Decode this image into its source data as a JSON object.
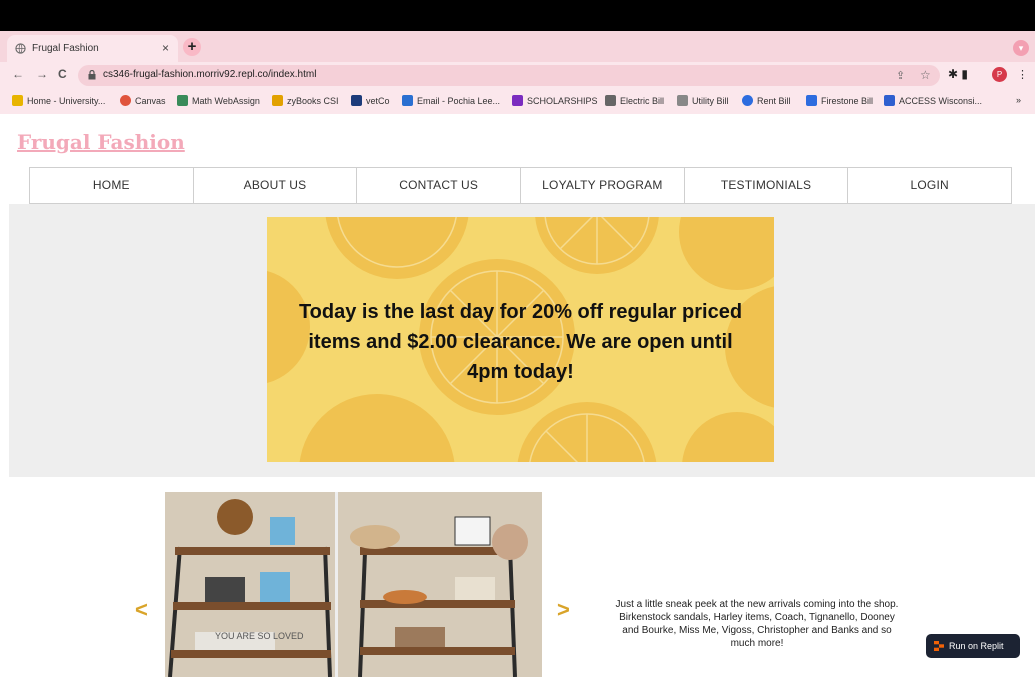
{
  "browser": {
    "tab_title": "Frugal Fashion",
    "tab_close": "×",
    "new_tab": "+",
    "url": "cs346-frugal-fashion.morriv92.repl.co/index.html",
    "back": "←",
    "forward": "→",
    "reload": "C",
    "bookmarks": [
      {
        "label": "Home - University...",
        "color": "#e8b400"
      },
      {
        "label": "Canvas",
        "color": "#e0533c"
      },
      {
        "label": "Math WebAssign",
        "color": "#3a8b5a"
      },
      {
        "label": "zyBooks CSI",
        "color": "#e2a100"
      },
      {
        "label": "vetCo",
        "color": "#1d3b7a"
      },
      {
        "label": "Email - Pochia Lee...",
        "color": "#2a6fd1"
      },
      {
        "label": "SCHOLARSHIPS",
        "color": "#7b2cbf"
      },
      {
        "label": "Electric Bill",
        "color": "#666666"
      },
      {
        "label": "Utility Bill",
        "color": "#666666"
      },
      {
        "label": "Rent Bill",
        "color": "#2d6cdf"
      },
      {
        "label": "Firestone Bill",
        "color": "#2d6cdf"
      },
      {
        "label": "ACCESS Wisconsi...",
        "color": "#2f5fcf"
      }
    ],
    "more_bookmarks": "»",
    "profile_initial": "P"
  },
  "site": {
    "logo": "Frugal Fashion",
    "nav": [
      "HOME",
      "ABOUT US",
      "CONTACT US",
      "LOYALTY PROGRAM",
      "TESTIMONIALS",
      "LOGIN"
    ],
    "promo_text": "Today is the last day for 20% off regular priced items and $2.00 clearance. We are open until 4pm today!",
    "carousel": {
      "prev": "<",
      "next": ">",
      "photo_sign": "YOU ARE SO LOVED",
      "caption": "Just a little sneak peek at the new arrivals coming into the shop. Birkenstock sandals, Harley items, Coach, Tignanello, Dooney and Bourke, Miss Me, Vigoss, Christopher and Banks and so much more!"
    },
    "run_button": "Run on Replit"
  },
  "colors": {
    "accent_pink": "#f3a9b9",
    "promo_yellow": "#f5d76e",
    "arrow_gold": "#d9a42a"
  }
}
